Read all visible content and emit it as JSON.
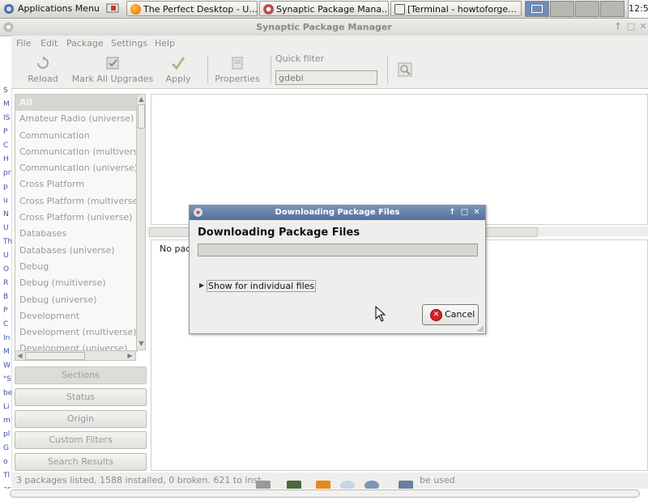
{
  "panel": {
    "apps_menu": "Applications Menu",
    "tasks": [
      "The Perfect Desktop - U...",
      "Synaptic Package Mana...",
      "[Terminal - howtoforge..."
    ],
    "clock": "12:5"
  },
  "window": {
    "title": "Synaptic Package Manager"
  },
  "menubar": [
    "File",
    "Edit",
    "Package",
    "Settings",
    "Help"
  ],
  "toolbar": {
    "reload": "Reload",
    "mark_all": "Mark All Upgrades",
    "apply": "Apply",
    "properties": "Properties",
    "quick_filter_label": "Quick filter",
    "quick_filter_value": "gdebi"
  },
  "sections": [
    "All",
    "Amateur Radio (universe)",
    "Communication",
    "Communication (multivers",
    "Communication (universe)",
    "Cross Platform",
    "Cross Platform (multiverse",
    "Cross Platform (universe)",
    "Databases",
    "Databases (universe)",
    "Debug",
    "Debug (multiverse)",
    "Debug (universe)",
    "Development",
    "Development (multiverse)",
    "Development (universe)"
  ],
  "filter_buttons": [
    "Sections",
    "Status",
    "Origin",
    "Custom Filters",
    "Search Results"
  ],
  "description_text": "No pac",
  "status": {
    "text": "3 packages listed, 1588 installed, 0 broken. 621 to inst",
    "tail": "be used"
  },
  "left_strip": [
    "S",
    "M",
    "IS",
    "P",
    "C",
    "H",
    "pr",
    "p",
    "u",
    "N",
    "U",
    "Th",
    "U",
    "O",
    "R",
    "B",
    "P",
    "C",
    "In",
    "M",
    "W",
    "\"S",
    "be",
    "Li",
    "m",
    "pl",
    "G",
    "o",
    "Tl",
    "ar"
  ],
  "dialog": {
    "title": "Downloading Package Files",
    "heading": "Downloading Package Files",
    "progress": 0,
    "expander": "Show for individual files",
    "cancel": "Cancel"
  },
  "colors": {
    "dialog_title_bar": "#5f7aa3",
    "cancel_icon": "#d32020"
  }
}
